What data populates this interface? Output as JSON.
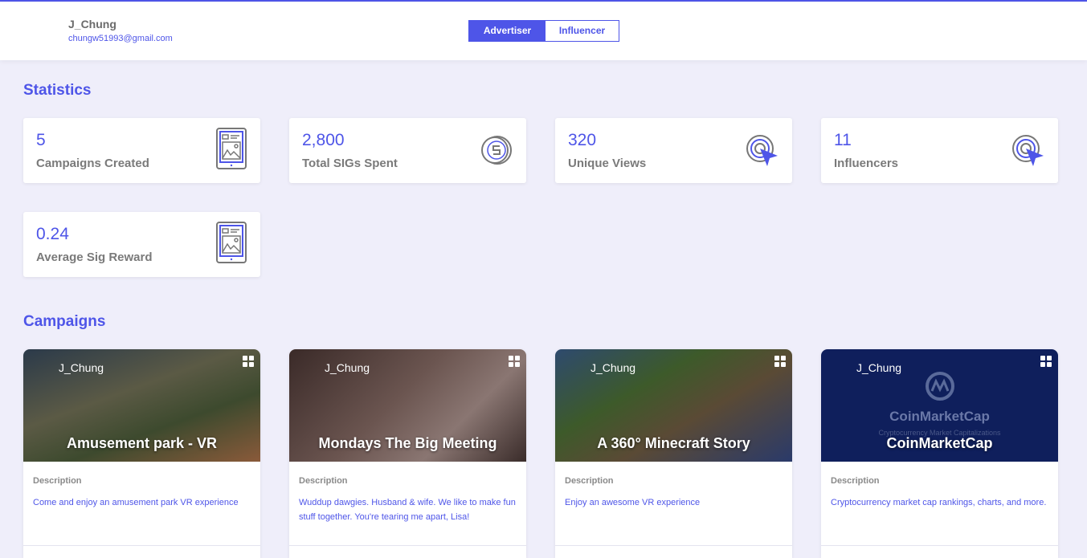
{
  "header": {
    "username": "J_Chung",
    "email": "chungw51993@gmail.com",
    "toggle": {
      "advertiser": "Advertiser",
      "influencer": "Influencer",
      "active": "Advertiser"
    }
  },
  "statistics": {
    "title": "Statistics",
    "items": [
      {
        "value": "5",
        "label": "Campaigns Created",
        "icon": "tablet-image-icon"
      },
      {
        "value": "2,800",
        "label": "Total SIGs Spent",
        "icon": "coin-icon"
      },
      {
        "value": "320",
        "label": "Unique Views",
        "icon": "target-cursor-icon"
      },
      {
        "value": "11",
        "label": "Influencers",
        "icon": "target-cursor-icon"
      },
      {
        "value": "0.24",
        "label": "Average Sig Reward",
        "icon": "tablet-image-icon"
      }
    ]
  },
  "campaigns": {
    "title": "Campaigns",
    "items": [
      {
        "owner": "J_Chung",
        "title": "Amusement park - VR",
        "description_label": "Description",
        "description": "Come and enjoy an amusement park VR experience"
      },
      {
        "owner": "J_Chung",
        "title": "Mondays The Big Meeting",
        "description_label": "Description",
        "description": "Wuddup dawgies. Husband & wife. We like to make fun stuff together. You're tearing me apart, Lisa!"
      },
      {
        "owner": "J_Chung",
        "title": "A 360° Minecraft Story",
        "description_label": "Description",
        "description": "Enjoy an awesome VR experience"
      },
      {
        "owner": "J_Chung",
        "title": "CoinMarketCap",
        "description_label": "Description",
        "description": "Cryptocurrency market cap rankings, charts, and more.",
        "logo_text": "CoinMarketCap",
        "logo_subtext": "Cryptocurrency Market Capitalizations"
      }
    ]
  },
  "colors": {
    "accent": "#4e55e8",
    "background": "#efeefa"
  }
}
